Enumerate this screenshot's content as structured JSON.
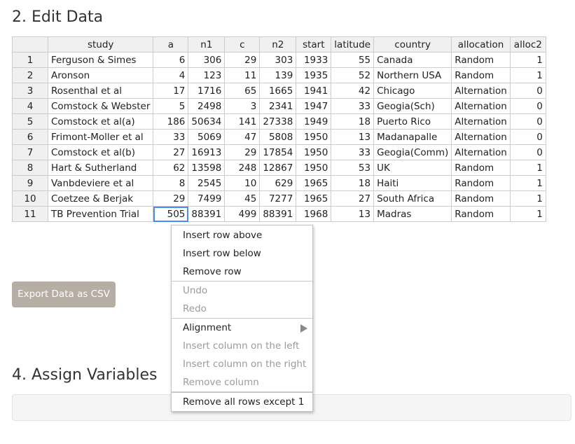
{
  "sections": {
    "edit_data_title": "2. Edit Data",
    "assign_variables_title": "4. Assign Variables"
  },
  "table": {
    "columns": [
      "study",
      "a",
      "n1",
      "c",
      "n2",
      "start",
      "latitude",
      "country",
      "allocation",
      "alloc2"
    ],
    "rows": [
      [
        "1",
        "Ferguson & Simes",
        "6",
        "306",
        "29",
        "303",
        "1933",
        "55",
        "Canada",
        "Random",
        "1"
      ],
      [
        "2",
        "Aronson",
        "4",
        "123",
        "11",
        "139",
        "1935",
        "52",
        "Northern USA",
        "Random",
        "1"
      ],
      [
        "3",
        "Rosenthal et al",
        "17",
        "1716",
        "65",
        "1665",
        "1941",
        "42",
        "Chicago",
        "Alternation",
        "0"
      ],
      [
        "4",
        "Comstock & Webster",
        "5",
        "2498",
        "3",
        "2341",
        "1947",
        "33",
        "Geogia(Sch)",
        "Alternation",
        "0"
      ],
      [
        "5",
        "Comstock et al(a)",
        "186",
        "50634",
        "141",
        "27338",
        "1949",
        "18",
        "Puerto Rico",
        "Alternation",
        "0"
      ],
      [
        "6",
        "Frimont-Moller et al",
        "33",
        "5069",
        "47",
        "5808",
        "1950",
        "13",
        "Madanapalle",
        "Alternation",
        "0"
      ],
      [
        "7",
        "Comstock et al(b)",
        "27",
        "16913",
        "29",
        "17854",
        "1950",
        "33",
        "Geogia(Comm)",
        "Alternation",
        "0"
      ],
      [
        "8",
        "Hart & Sutherland",
        "62",
        "13598",
        "248",
        "12867",
        "1950",
        "53",
        "UK",
        "Random",
        "1"
      ],
      [
        "9",
        "Vanbdeviere et al",
        "8",
        "2545",
        "10",
        "629",
        "1965",
        "18",
        "Haiti",
        "Random",
        "1"
      ],
      [
        "10",
        "Coetzee & Berjak",
        "29",
        "7499",
        "45",
        "7277",
        "1965",
        "27",
        "South Africa",
        "Random",
        "1"
      ],
      [
        "11",
        "TB Prevention Trial",
        "505",
        "88391",
        "499",
        "88391",
        "1968",
        "13",
        "Madras",
        "Random",
        "1"
      ]
    ],
    "selected_cell": {
      "row": 11,
      "column": "a"
    }
  },
  "export_button_label": "Export Data as CSV",
  "context_menu": {
    "items": [
      {
        "label": "Insert row above",
        "enabled": true
      },
      {
        "label": "Insert row below",
        "enabled": true
      },
      {
        "label": "Remove row",
        "enabled": true
      },
      {
        "label": "Undo",
        "enabled": false
      },
      {
        "label": "Redo",
        "enabled": false
      },
      {
        "label": "Alignment",
        "enabled": true,
        "submenu": true
      },
      {
        "label": "Insert column on the left",
        "enabled": false
      },
      {
        "label": "Insert column on the right",
        "enabled": false
      },
      {
        "label": "Remove column",
        "enabled": false
      },
      {
        "label": "Remove all rows except 1",
        "enabled": true
      }
    ],
    "submenu_icon": "triangle-right-icon"
  },
  "colors": {
    "export_button_bg": "#b6aea5",
    "selection_border": "#4b89ff",
    "header_bg": "#f0f0f0",
    "disabled_text": "#9a9a9a"
  }
}
